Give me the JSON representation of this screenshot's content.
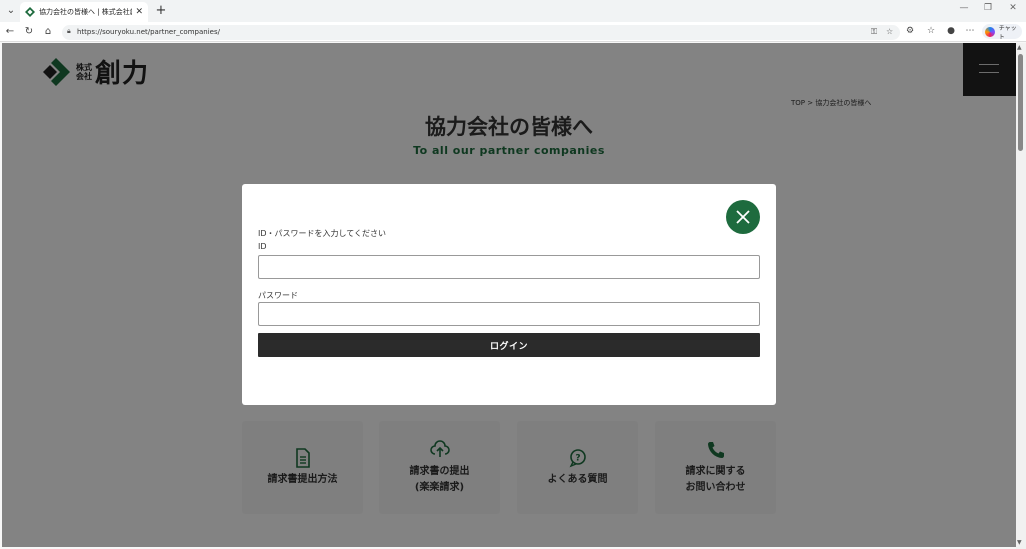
{
  "browser": {
    "tab_title": "協力会社の皆様へ | 株式会社創力",
    "tab_close": "✕",
    "new_tab": "+",
    "url": "https://souryoku.net/partner_companies/",
    "chat_label": "チャット"
  },
  "site": {
    "logo_small_line1": "株式",
    "logo_small_line2": "会社",
    "logo_big": "創力",
    "brand_color": "#1e6b3e"
  },
  "page": {
    "breadcrumb": "TOP > 協力会社の皆様へ",
    "title": "協力会社の皆様へ",
    "subtitle": "To all our partner companies"
  },
  "modal": {
    "instruction": "ID・パスワードを入力してください",
    "id_label": "ID",
    "id_value": "",
    "password_label": "パスワード",
    "password_value": "",
    "login_label": "ログイン"
  },
  "cards": [
    {
      "label": "請求書提出方法",
      "icon": "document-icon"
    },
    {
      "label": "請求書の提出\n(楽楽請求)",
      "icon": "cloud-upload-icon"
    },
    {
      "label": "よくある質問",
      "icon": "question-bubble-icon"
    },
    {
      "label": "請求に関する\nお問い合わせ",
      "icon": "phone-icon"
    }
  ]
}
